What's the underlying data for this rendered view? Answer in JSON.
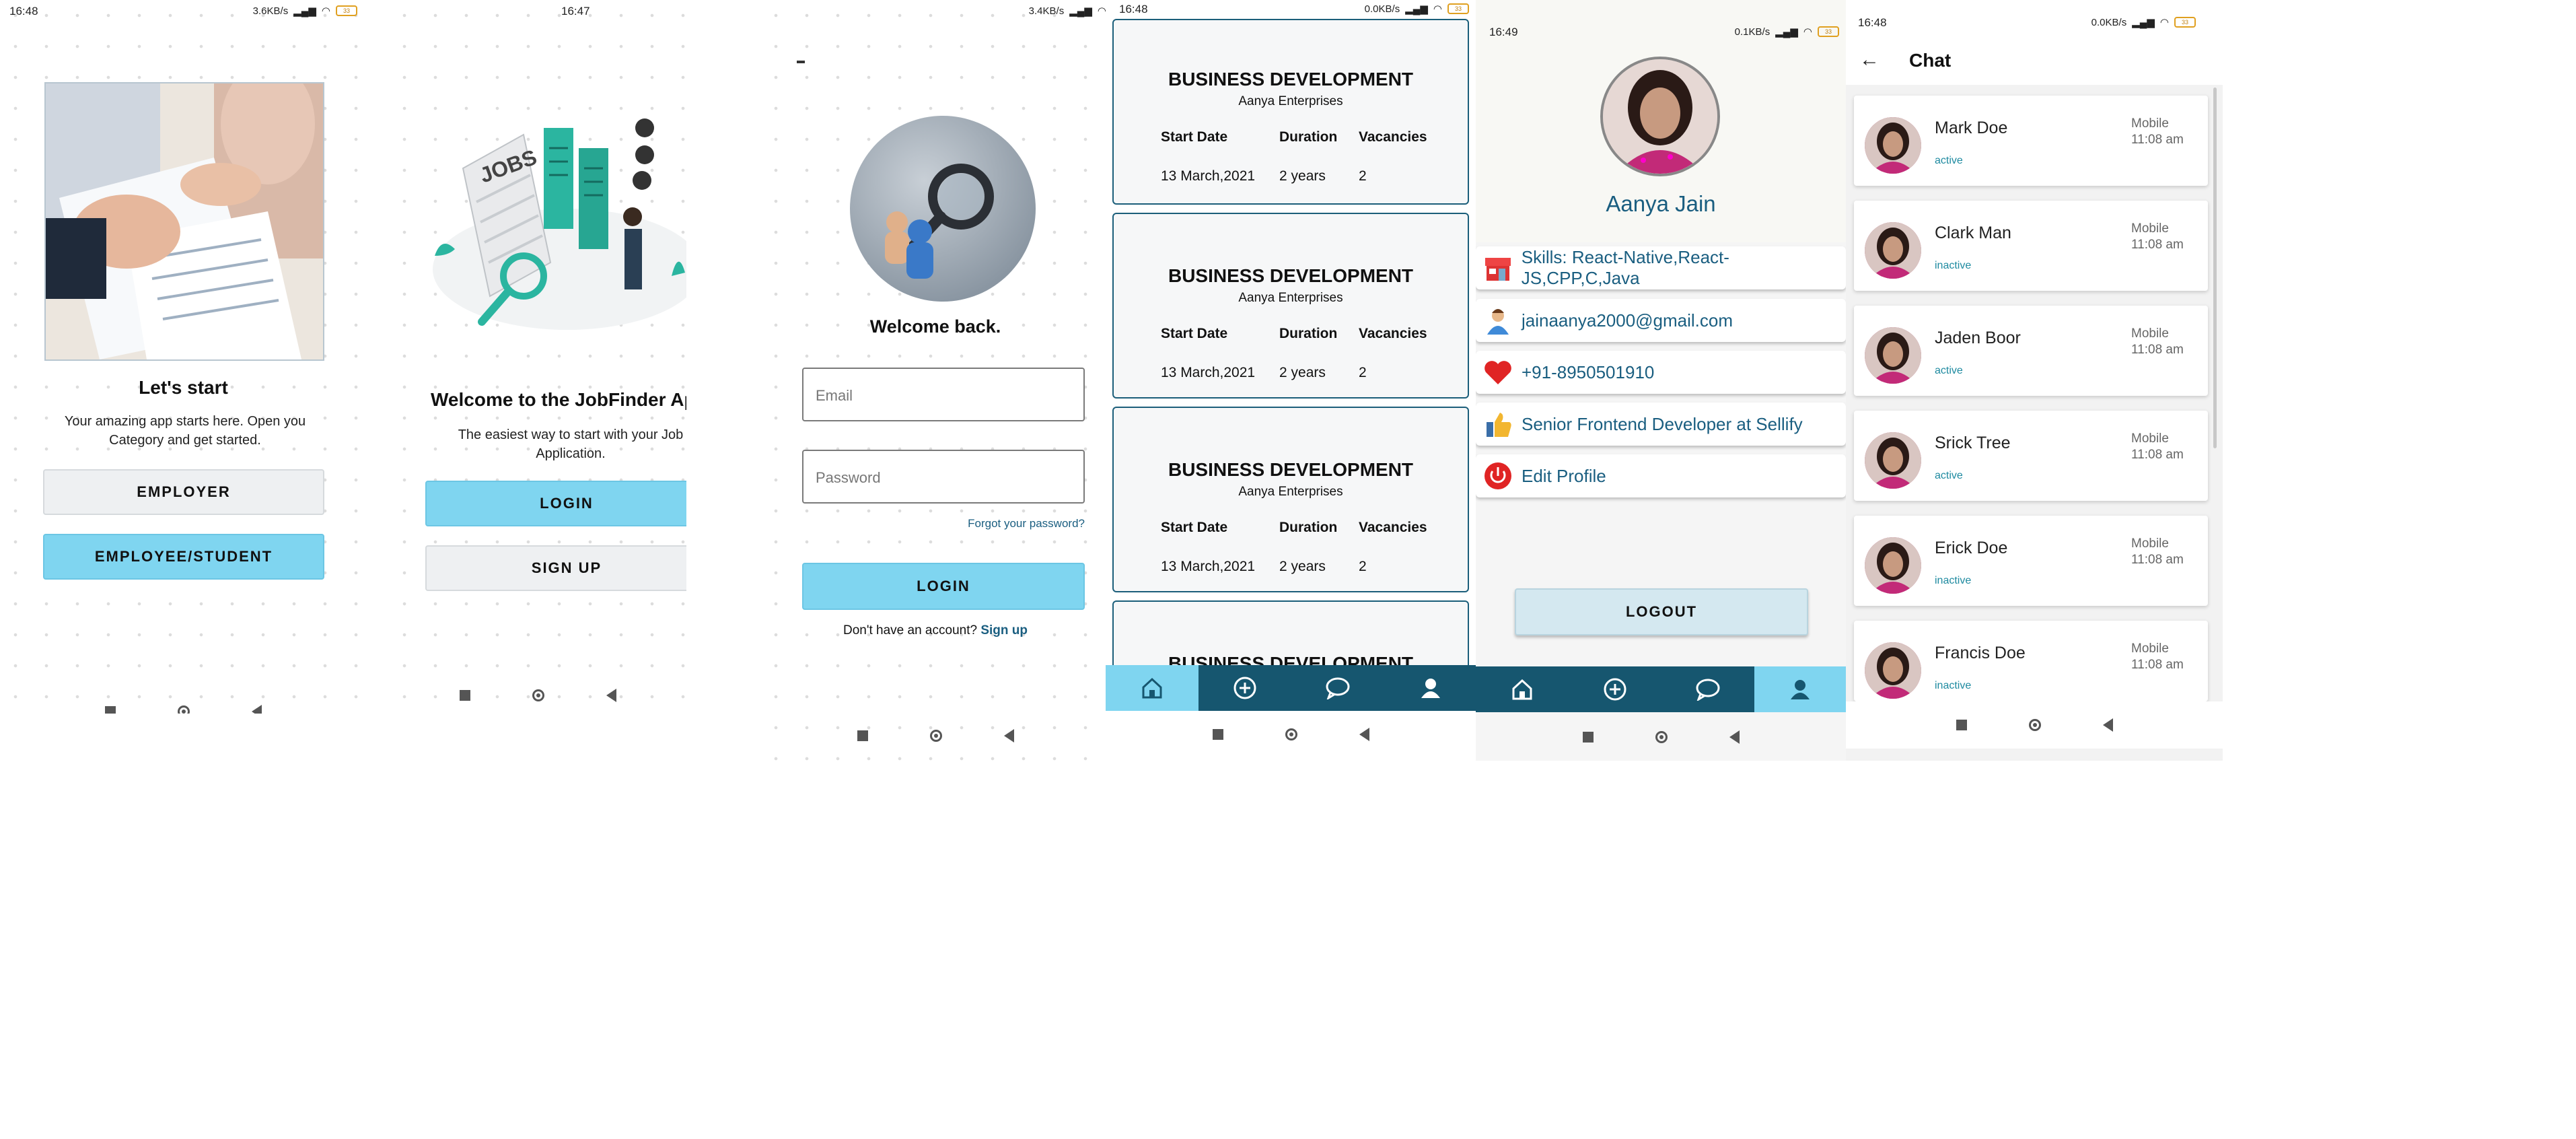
{
  "screen1": {
    "status": {
      "time": "16:48",
      "speed": "3.6KB/s",
      "battery": "33"
    },
    "heading": "Let's start",
    "subtitle": "Your amazing app starts here. Open you Category and get started.",
    "employer_btn": "EMPLOYER",
    "student_btn": "EMPLOYEE/STUDENT"
  },
  "screen2": {
    "status": {
      "time": "16:47"
    },
    "illustration_label": "JOBS",
    "heading": "Welcome to the JobFinder App",
    "subtitle": "The easiest way to start with your Job Application.",
    "login_btn": "LOGIN",
    "signup_btn": "SIGN UP"
  },
  "screen3": {
    "status": {
      "speed": "3.4KB/s"
    },
    "welcome": "Welcome back.",
    "email_placeholder": "Email",
    "password_placeholder": "Password",
    "forgot": "Forgot your password?",
    "login_btn": "LOGIN",
    "no_account": "Don't have an account?",
    "signup_link": "Sign up"
  },
  "screen4": {
    "status": {
      "time": "16:48",
      "speed": "0.0KB/s",
      "battery": "33"
    },
    "headers": {
      "start": "Start Date",
      "duration": "Duration",
      "vacancies": "Vacancies"
    },
    "jobs": [
      {
        "title": "BUSINESS DEVELOPMENT",
        "company": "Aanya Enterprises",
        "start": "13 March,2021",
        "duration": "2 years",
        "vacancies": "2"
      },
      {
        "title": "BUSINESS DEVELOPMENT",
        "company": "Aanya Enterprises",
        "start": "13 March,2021",
        "duration": "2 years",
        "vacancies": "2"
      },
      {
        "title": "BUSINESS DEVELOPMENT",
        "company": "Aanya Enterprises",
        "start": "13 March,2021",
        "duration": "2 years",
        "vacancies": "2"
      },
      {
        "title": "BUSINESS DEVELOPMENT"
      }
    ],
    "tabs": [
      "home-icon",
      "add-icon",
      "chat-icon",
      "person-icon"
    ],
    "active_tab": 0
  },
  "screen5": {
    "status": {
      "time": "16:49",
      "speed": "0.1KB/s",
      "battery": "33"
    },
    "name": "Aanya Jain",
    "skills": "Skills: React-Native,React-JS,CPP,C,Java",
    "email": "jainaanya2000@gmail.com",
    "phone": "+91-8950501910",
    "job": "Senior Frontend Developer at Sellify",
    "edit": "Edit Profile",
    "logout_btn": "LOGOUT",
    "active_tab": 3
  },
  "screen6": {
    "status": {
      "time": "16:48",
      "speed": "0.0KB/s",
      "battery": "33"
    },
    "title": "Chat",
    "contacts": [
      {
        "name": "Mark Doe",
        "status": "active",
        "device": "Mobile",
        "time": "11:08 am"
      },
      {
        "name": "Clark Man",
        "status": "inactive",
        "device": "Mobile",
        "time": "11:08 am"
      },
      {
        "name": "Jaden Boor",
        "status": "active",
        "device": "Mobile",
        "time": "11:08 am"
      },
      {
        "name": "Srick Tree",
        "status": "active",
        "device": "Mobile",
        "time": "11:08 am"
      },
      {
        "name": "Erick Doe",
        "status": "inactive",
        "device": "Mobile",
        "time": "11:08 am"
      },
      {
        "name": "Francis Doe",
        "status": "inactive",
        "device": "Mobile",
        "time": "11:08 am"
      }
    ]
  },
  "colors": {
    "accent": "#7fd5f0",
    "tabbar": "#16566f",
    "link": "#1a5e80",
    "status_text": "#1e8aa0"
  }
}
